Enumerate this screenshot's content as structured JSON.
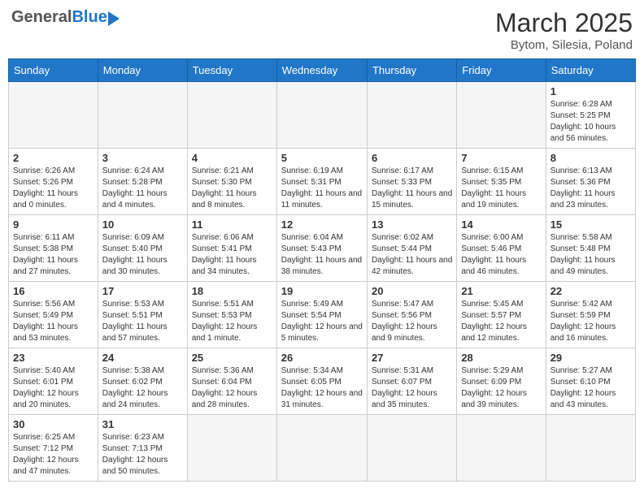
{
  "header": {
    "logo_general": "General",
    "logo_blue": "Blue",
    "month_title": "March 2025",
    "location": "Bytom, Silesia, Poland"
  },
  "days_of_week": [
    "Sunday",
    "Monday",
    "Tuesday",
    "Wednesday",
    "Thursday",
    "Friday",
    "Saturday"
  ],
  "weeks": [
    [
      {
        "day": "",
        "info": ""
      },
      {
        "day": "",
        "info": ""
      },
      {
        "day": "",
        "info": ""
      },
      {
        "day": "",
        "info": ""
      },
      {
        "day": "",
        "info": ""
      },
      {
        "day": "",
        "info": ""
      },
      {
        "day": "1",
        "info": "Sunrise: 6:28 AM\nSunset: 5:25 PM\nDaylight: 10 hours\nand 56 minutes."
      }
    ],
    [
      {
        "day": "2",
        "info": "Sunrise: 6:26 AM\nSunset: 5:26 PM\nDaylight: 11 hours\nand 0 minutes."
      },
      {
        "day": "3",
        "info": "Sunrise: 6:24 AM\nSunset: 5:28 PM\nDaylight: 11 hours\nand 4 minutes."
      },
      {
        "day": "4",
        "info": "Sunrise: 6:21 AM\nSunset: 5:30 PM\nDaylight: 11 hours\nand 8 minutes."
      },
      {
        "day": "5",
        "info": "Sunrise: 6:19 AM\nSunset: 5:31 PM\nDaylight: 11 hours\nand 11 minutes."
      },
      {
        "day": "6",
        "info": "Sunrise: 6:17 AM\nSunset: 5:33 PM\nDaylight: 11 hours\nand 15 minutes."
      },
      {
        "day": "7",
        "info": "Sunrise: 6:15 AM\nSunset: 5:35 PM\nDaylight: 11 hours\nand 19 minutes."
      },
      {
        "day": "8",
        "info": "Sunrise: 6:13 AM\nSunset: 5:36 PM\nDaylight: 11 hours\nand 23 minutes."
      }
    ],
    [
      {
        "day": "9",
        "info": "Sunrise: 6:11 AM\nSunset: 5:38 PM\nDaylight: 11 hours\nand 27 minutes."
      },
      {
        "day": "10",
        "info": "Sunrise: 6:09 AM\nSunset: 5:40 PM\nDaylight: 11 hours\nand 30 minutes."
      },
      {
        "day": "11",
        "info": "Sunrise: 6:06 AM\nSunset: 5:41 PM\nDaylight: 11 hours\nand 34 minutes."
      },
      {
        "day": "12",
        "info": "Sunrise: 6:04 AM\nSunset: 5:43 PM\nDaylight: 11 hours\nand 38 minutes."
      },
      {
        "day": "13",
        "info": "Sunrise: 6:02 AM\nSunset: 5:44 PM\nDaylight: 11 hours\nand 42 minutes."
      },
      {
        "day": "14",
        "info": "Sunrise: 6:00 AM\nSunset: 5:46 PM\nDaylight: 11 hours\nand 46 minutes."
      },
      {
        "day": "15",
        "info": "Sunrise: 5:58 AM\nSunset: 5:48 PM\nDaylight: 11 hours\nand 49 minutes."
      }
    ],
    [
      {
        "day": "16",
        "info": "Sunrise: 5:56 AM\nSunset: 5:49 PM\nDaylight: 11 hours\nand 53 minutes."
      },
      {
        "day": "17",
        "info": "Sunrise: 5:53 AM\nSunset: 5:51 PM\nDaylight: 11 hours\nand 57 minutes."
      },
      {
        "day": "18",
        "info": "Sunrise: 5:51 AM\nSunset: 5:53 PM\nDaylight: 12 hours\nand 1 minute."
      },
      {
        "day": "19",
        "info": "Sunrise: 5:49 AM\nSunset: 5:54 PM\nDaylight: 12 hours\nand 5 minutes."
      },
      {
        "day": "20",
        "info": "Sunrise: 5:47 AM\nSunset: 5:56 PM\nDaylight: 12 hours\nand 9 minutes."
      },
      {
        "day": "21",
        "info": "Sunrise: 5:45 AM\nSunset: 5:57 PM\nDaylight: 12 hours\nand 12 minutes."
      },
      {
        "day": "22",
        "info": "Sunrise: 5:42 AM\nSunset: 5:59 PM\nDaylight: 12 hours\nand 16 minutes."
      }
    ],
    [
      {
        "day": "23",
        "info": "Sunrise: 5:40 AM\nSunset: 6:01 PM\nDaylight: 12 hours\nand 20 minutes."
      },
      {
        "day": "24",
        "info": "Sunrise: 5:38 AM\nSunset: 6:02 PM\nDaylight: 12 hours\nand 24 minutes."
      },
      {
        "day": "25",
        "info": "Sunrise: 5:36 AM\nSunset: 6:04 PM\nDaylight: 12 hours\nand 28 minutes."
      },
      {
        "day": "26",
        "info": "Sunrise: 5:34 AM\nSunset: 6:05 PM\nDaylight: 12 hours\nand 31 minutes."
      },
      {
        "day": "27",
        "info": "Sunrise: 5:31 AM\nSunset: 6:07 PM\nDaylight: 12 hours\nand 35 minutes."
      },
      {
        "day": "28",
        "info": "Sunrise: 5:29 AM\nSunset: 6:09 PM\nDaylight: 12 hours\nand 39 minutes."
      },
      {
        "day": "29",
        "info": "Sunrise: 5:27 AM\nSunset: 6:10 PM\nDaylight: 12 hours\nand 43 minutes."
      }
    ],
    [
      {
        "day": "30",
        "info": "Sunrise: 6:25 AM\nSunset: 7:12 PM\nDaylight: 12 hours\nand 47 minutes."
      },
      {
        "day": "31",
        "info": "Sunrise: 6:23 AM\nSunset: 7:13 PM\nDaylight: 12 hours\nand 50 minutes."
      },
      {
        "day": "",
        "info": ""
      },
      {
        "day": "",
        "info": ""
      },
      {
        "day": "",
        "info": ""
      },
      {
        "day": "",
        "info": ""
      },
      {
        "day": "",
        "info": ""
      }
    ]
  ]
}
